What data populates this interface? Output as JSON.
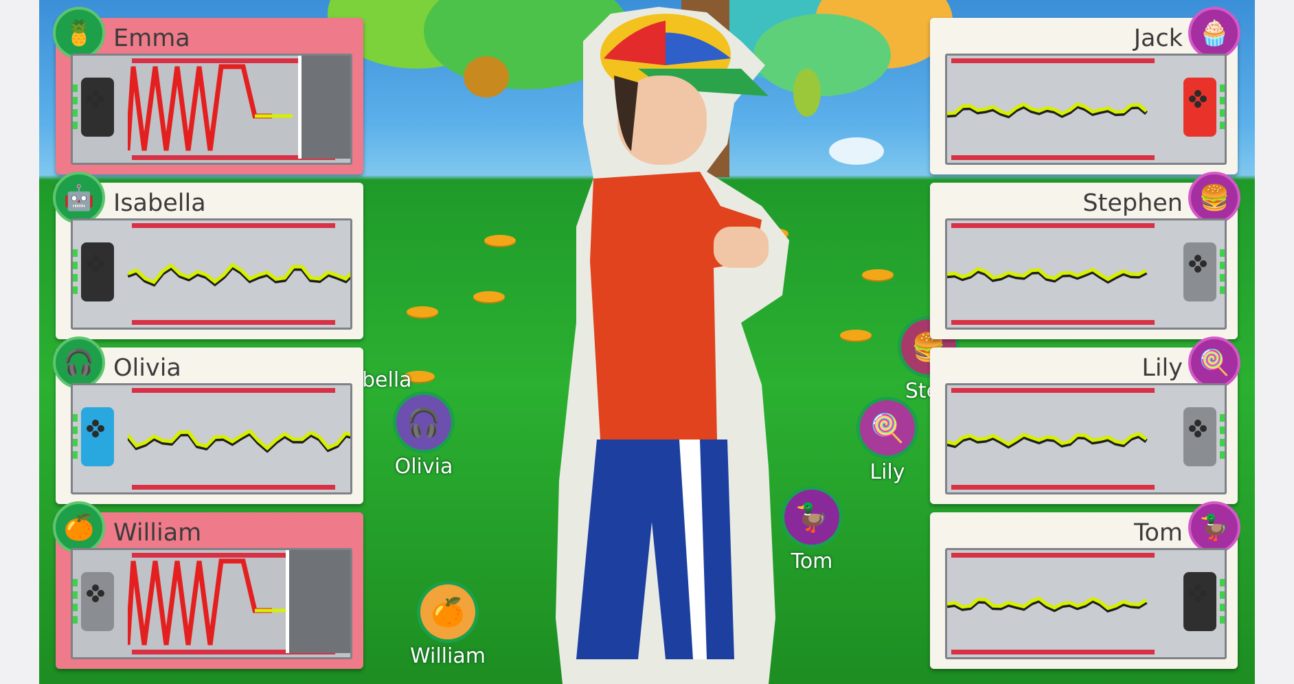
{
  "players_left": [
    {
      "name": "Emma",
      "avatar": "pineapple-sunglasses-icon",
      "highlighted": true,
      "status": "shaking",
      "controller_color": "#2f2f2f"
    },
    {
      "name": "Isabella",
      "avatar": "robot-icon",
      "highlighted": false,
      "status": "steady",
      "controller_color": "#2f2f2f"
    },
    {
      "name": "Olivia",
      "avatar": "headphones-ball-icon",
      "highlighted": false,
      "status": "steady",
      "controller_color": "#29a8e0"
    },
    {
      "name": "William",
      "avatar": "grapefruit-mustache-icon",
      "highlighted": true,
      "status": "shaking",
      "controller_color": "#8a8d92"
    }
  ],
  "players_right": [
    {
      "name": "Jack",
      "avatar": "cupcake-icon",
      "highlighted": false,
      "status": "steady",
      "controller_color": "#e8322a"
    },
    {
      "name": "Stephen",
      "avatar": "hamburger-icon",
      "highlighted": false,
      "status": "steady",
      "controller_color": "#8a8d92"
    },
    {
      "name": "Lily",
      "avatar": "lollipop-icon",
      "highlighted": false,
      "status": "steady",
      "controller_color": "#8a8d92"
    },
    {
      "name": "Tom",
      "avatar": "rubber-duck-icon",
      "highlighted": false,
      "status": "steady",
      "controller_color": "#2f2f2f"
    }
  ],
  "field_pointers": {
    "isabella": "bella",
    "olivia": "Olivia",
    "william": "William",
    "stephen": "Step",
    "lily": "Lily",
    "tom": "Tom"
  },
  "colors": {
    "alert_panel": "#ee7a8a",
    "panel": "#f7f4ec",
    "trace_yellow": "#d6f000",
    "trace_red": "#e41f1f"
  }
}
